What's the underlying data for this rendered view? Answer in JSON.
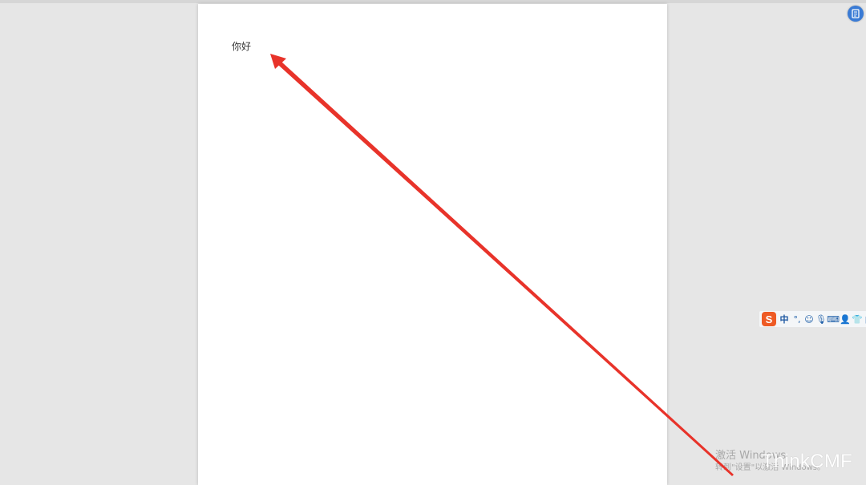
{
  "document": {
    "text": "你好"
  },
  "app_button": {
    "icon": "document-icon"
  },
  "ime_toolbar": {
    "logo": "S",
    "mode": "中",
    "items": [
      {
        "name": "punctuation-icon",
        "glyph": "°,"
      },
      {
        "name": "emoji-icon",
        "glyph": "☺"
      },
      {
        "name": "microphone-icon",
        "glyph": "🎙"
      },
      {
        "name": "keyboard-icon",
        "glyph": "⌨"
      },
      {
        "name": "user-icon",
        "glyph": "👤"
      },
      {
        "name": "skin-icon",
        "glyph": "👕"
      },
      {
        "name": "grid-icon",
        "glyph": "▦"
      }
    ]
  },
  "activation": {
    "line1": "激活 Windows",
    "line2": "转到\"设置\"以激活 Windows。"
  },
  "watermark": {
    "text": "ThinkCMF"
  },
  "colors": {
    "arrow": "#e8332a",
    "background": "#e6e6e6",
    "page": "#ffffff",
    "accent": "#3a7bd5"
  }
}
